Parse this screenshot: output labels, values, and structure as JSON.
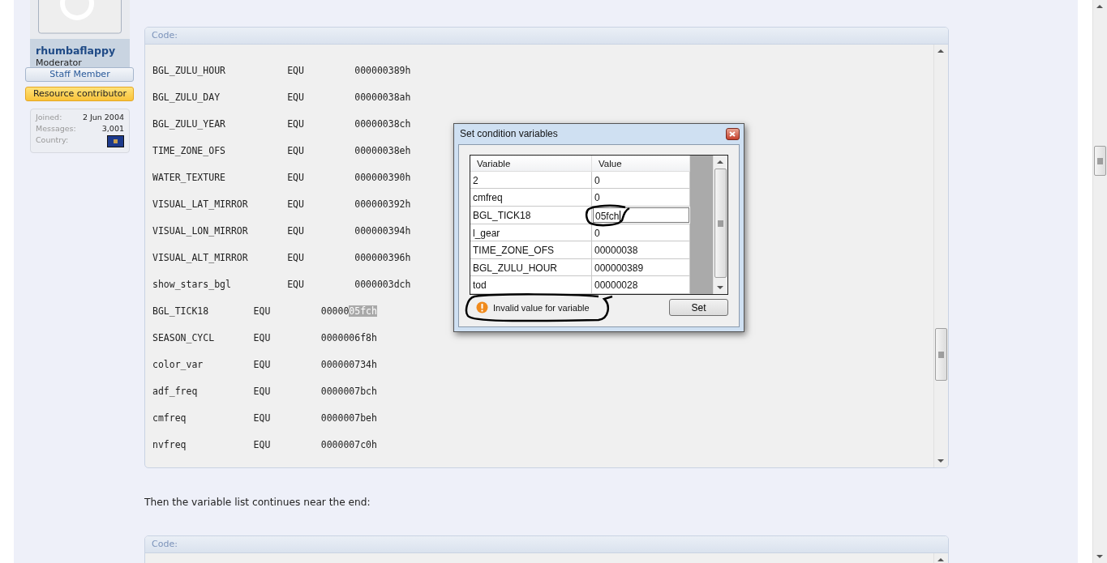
{
  "user": {
    "name": "rhumbaflappy",
    "title": "Moderator",
    "banners": [
      {
        "label": "Staff Member",
        "kind": "staff"
      },
      {
        "label": "Resource contributor",
        "kind": "contributor"
      }
    ],
    "info": [
      {
        "label": "Joined:",
        "value": "2 Jun 2004"
      },
      {
        "label": "Messages:",
        "value": "3,001"
      },
      {
        "label": "Country:",
        "kind": "flag"
      }
    ]
  },
  "code_block": {
    "header": "Code:",
    "rows": [
      {
        "name": "BGL_ZULU_HOUR",
        "op": "EQU",
        "value": "000000389h"
      },
      {
        "name": "BGL_ZULU_DAY",
        "op": "EQU",
        "value": "00000038ah"
      },
      {
        "name": "BGL_ZULU_YEAR",
        "op": "EQU",
        "value": "00000038ch"
      },
      {
        "name": "TIME_ZONE_OFS",
        "op": "EQU",
        "value": "00000038eh"
      },
      {
        "name": "WATER_TEXTURE",
        "op": "EQU",
        "value": "000000390h"
      },
      {
        "name": "VISUAL_LAT_MIRROR",
        "op": "EQU",
        "value": "000000392h"
      },
      {
        "name": "VISUAL_LON_MIRROR",
        "op": "EQU",
        "value": "000000394h"
      },
      {
        "name": "VISUAL_ALT_MIRROR",
        "op": "EQU",
        "value": "000000396h"
      },
      {
        "name": "show_stars_bgl",
        "op": "EQU",
        "value": "0000003dch"
      },
      {
        "name": "BGL_TICK18",
        "op": "EQU",
        "value": "00000",
        "selected_text": "05fch"
      },
      {
        "name": "SEASON_CYCL",
        "op": "EQU",
        "value": "0000006f8h"
      },
      {
        "name": "color_var",
        "op": "EQU",
        "value": "000000734h"
      },
      {
        "name": "adf_freq",
        "op": "EQU",
        "value": "0000007bch"
      },
      {
        "name": "cmfreq",
        "op": "EQU",
        "value": "0000007beh"
      },
      {
        "name": "nvfreq",
        "op": "EQU",
        "value": "0000007c0h"
      }
    ]
  },
  "paragraph": "Then the variable list continues near the end:",
  "code_block_2": {
    "header": "Code:"
  },
  "dialog": {
    "title": "Set condition variables",
    "columns": [
      "Variable",
      "Value"
    ],
    "rows": [
      {
        "variable": "2",
        "value": "0",
        "editing": false
      },
      {
        "variable": "cmfreq",
        "value": "0",
        "editing": false
      },
      {
        "variable": "BGL_TICK18",
        "value": "05fch",
        "editing": true
      },
      {
        "variable": "l_gear",
        "value": "0",
        "editing": false
      },
      {
        "variable": "TIME_ZONE_OFS",
        "value": "00000038",
        "editing": false
      },
      {
        "variable": "BGL_ZULU_HOUR",
        "value": "000000389",
        "editing": false
      },
      {
        "variable": "tod",
        "value": "00000028",
        "editing": false
      }
    ],
    "error": "Invalid value for variable",
    "button": "Set"
  }
}
